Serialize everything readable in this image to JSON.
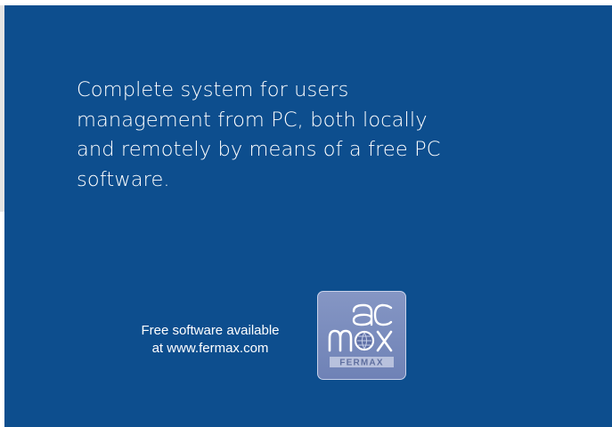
{
  "description": {
    "lines": [
      "Complete system for users",
      "management from PC, both locally",
      "and remotely by means of a free PC",
      "software."
    ]
  },
  "download_note": {
    "line1": "Free software available",
    "line2": "at www.fermax.com"
  },
  "app_icon": {
    "name": "acmax-fermax-logo",
    "wordmark_top": "ac",
    "wordmark_bottom": "max",
    "brand": "FERMAX"
  },
  "colors": {
    "panel_background": "#0d4e8e",
    "text": "#ffffff",
    "icon_background": "#7b8dbd"
  }
}
